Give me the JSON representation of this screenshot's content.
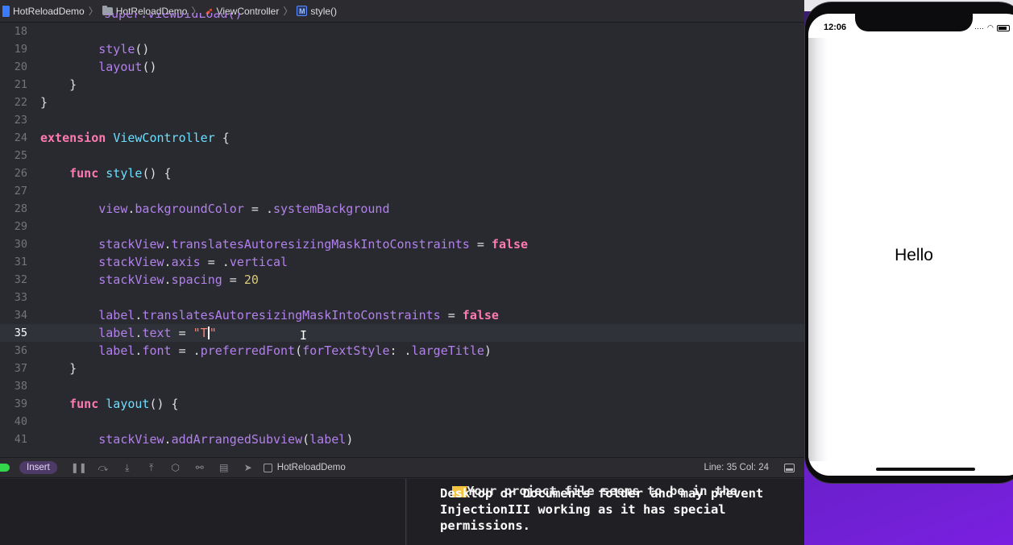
{
  "jumpbar": {
    "crumbs": [
      "HotReloadDemo",
      "HotReloadDemo",
      "ViewController",
      "style()"
    ],
    "method_badge": "M"
  },
  "editor": {
    "partial_top_line": "super.viewDidLoad()",
    "lines": [
      {
        "n": "18",
        "tokens": []
      },
      {
        "n": "19",
        "tokens": [
          [
            "",
            "        "
          ],
          [
            "pr",
            "style"
          ],
          [
            "",
            "()"
          ]
        ]
      },
      {
        "n": "20",
        "tokens": [
          [
            "",
            "        "
          ],
          [
            "pr",
            "layout"
          ],
          [
            "",
            "()"
          ]
        ]
      },
      {
        "n": "21",
        "tokens": [
          [
            "",
            "    }"
          ]
        ]
      },
      {
        "n": "22",
        "tokens": [
          [
            "",
            "}"
          ]
        ]
      },
      {
        "n": "23",
        "tokens": []
      },
      {
        "n": "24",
        "tokens": [
          [
            "kw",
            "extension"
          ],
          [
            "",
            " "
          ],
          [
            "ty",
            "ViewController"
          ],
          [
            "",
            " {"
          ]
        ]
      },
      {
        "n": "25",
        "tokens": []
      },
      {
        "n": "26",
        "tokens": [
          [
            "",
            "    "
          ],
          [
            "kw",
            "func"
          ],
          [
            "",
            " "
          ],
          [
            "ty",
            "style"
          ],
          [
            "",
            "() {"
          ]
        ]
      },
      {
        "n": "27",
        "tokens": []
      },
      {
        "n": "28",
        "tokens": [
          [
            "",
            "        "
          ],
          [
            "pr",
            "view"
          ],
          [
            "",
            "."
          ],
          [
            "pr",
            "backgroundColor"
          ],
          [
            "",
            " = ."
          ],
          [
            "pr",
            "systemBackground"
          ]
        ]
      },
      {
        "n": "29",
        "tokens": []
      },
      {
        "n": "30",
        "tokens": [
          [
            "",
            "        "
          ],
          [
            "pr",
            "stackView"
          ],
          [
            "",
            "."
          ],
          [
            "pr",
            "translatesAutoresizingMaskIntoConstraints"
          ],
          [
            "",
            " = "
          ],
          [
            "kw",
            "false"
          ]
        ]
      },
      {
        "n": "31",
        "tokens": [
          [
            "",
            "        "
          ],
          [
            "pr",
            "stackView"
          ],
          [
            "",
            "."
          ],
          [
            "pr",
            "axis"
          ],
          [
            "",
            " = ."
          ],
          [
            "pr",
            "vertical"
          ]
        ]
      },
      {
        "n": "32",
        "tokens": [
          [
            "",
            "        "
          ],
          [
            "pr",
            "stackView"
          ],
          [
            "",
            "."
          ],
          [
            "pr",
            "spacing"
          ],
          [
            "",
            " = "
          ],
          [
            "num",
            "20"
          ]
        ]
      },
      {
        "n": "33",
        "tokens": []
      },
      {
        "n": "34",
        "tokens": [
          [
            "",
            "        "
          ],
          [
            "pr",
            "label"
          ],
          [
            "",
            "."
          ],
          [
            "pr",
            "translatesAutoresizingMaskIntoConstraints"
          ],
          [
            "",
            " = "
          ],
          [
            "kw",
            "false"
          ]
        ]
      },
      {
        "n": "35",
        "current": true,
        "tokens": [
          [
            "",
            "        "
          ],
          [
            "pr",
            "label"
          ],
          [
            "",
            "."
          ],
          [
            "pr",
            "text"
          ],
          [
            "",
            " = "
          ],
          [
            "str",
            "\"T"
          ],
          [
            "caret",
            ""
          ],
          [
            "str",
            "\""
          ]
        ]
      },
      {
        "n": "36",
        "tokens": [
          [
            "",
            "        "
          ],
          [
            "pr",
            "label"
          ],
          [
            "",
            "."
          ],
          [
            "pr",
            "font"
          ],
          [
            "",
            " = ."
          ],
          [
            "pr",
            "preferredFont"
          ],
          [
            "",
            "("
          ],
          [
            "pr",
            "forTextStyle"
          ],
          [
            "",
            ": ."
          ],
          [
            "pr",
            "largeTitle"
          ],
          [
            "",
            ")"
          ]
        ]
      },
      {
        "n": "37",
        "tokens": [
          [
            "",
            "    }"
          ]
        ]
      },
      {
        "n": "38",
        "tokens": []
      },
      {
        "n": "39",
        "tokens": [
          [
            "",
            "    "
          ],
          [
            "kw",
            "func"
          ],
          [
            "",
            " "
          ],
          [
            "ty",
            "layout"
          ],
          [
            "",
            "() {"
          ]
        ]
      },
      {
        "n": "40",
        "tokens": []
      },
      {
        "n": "41",
        "tokens": [
          [
            "",
            "        "
          ],
          [
            "pr",
            "stackView"
          ],
          [
            "",
            "."
          ],
          [
            "pr",
            "addArrangedSubview"
          ],
          [
            "",
            "("
          ],
          [
            "pr",
            "label"
          ],
          [
            "",
            ")"
          ]
        ]
      }
    ]
  },
  "statusbar": {
    "mode": "Insert",
    "target": "HotReloadDemo",
    "position": "Line: 35  Col: 24"
  },
  "console": {
    "cut_line": "Your project file seems to be in the",
    "lines": [
      "Desktop or Documents folder and may prevent",
      "InjectionIII working as it has special",
      "permissions."
    ]
  },
  "simulator": {
    "clock": "12:06",
    "label_text": "Hello"
  },
  "colors": {
    "editor_bg": "#292a30",
    "keyword": "#ff7ab2",
    "type": "#6bdfff",
    "property": "#b281eb",
    "string": "#ff8170",
    "number": "#d9c97c"
  }
}
